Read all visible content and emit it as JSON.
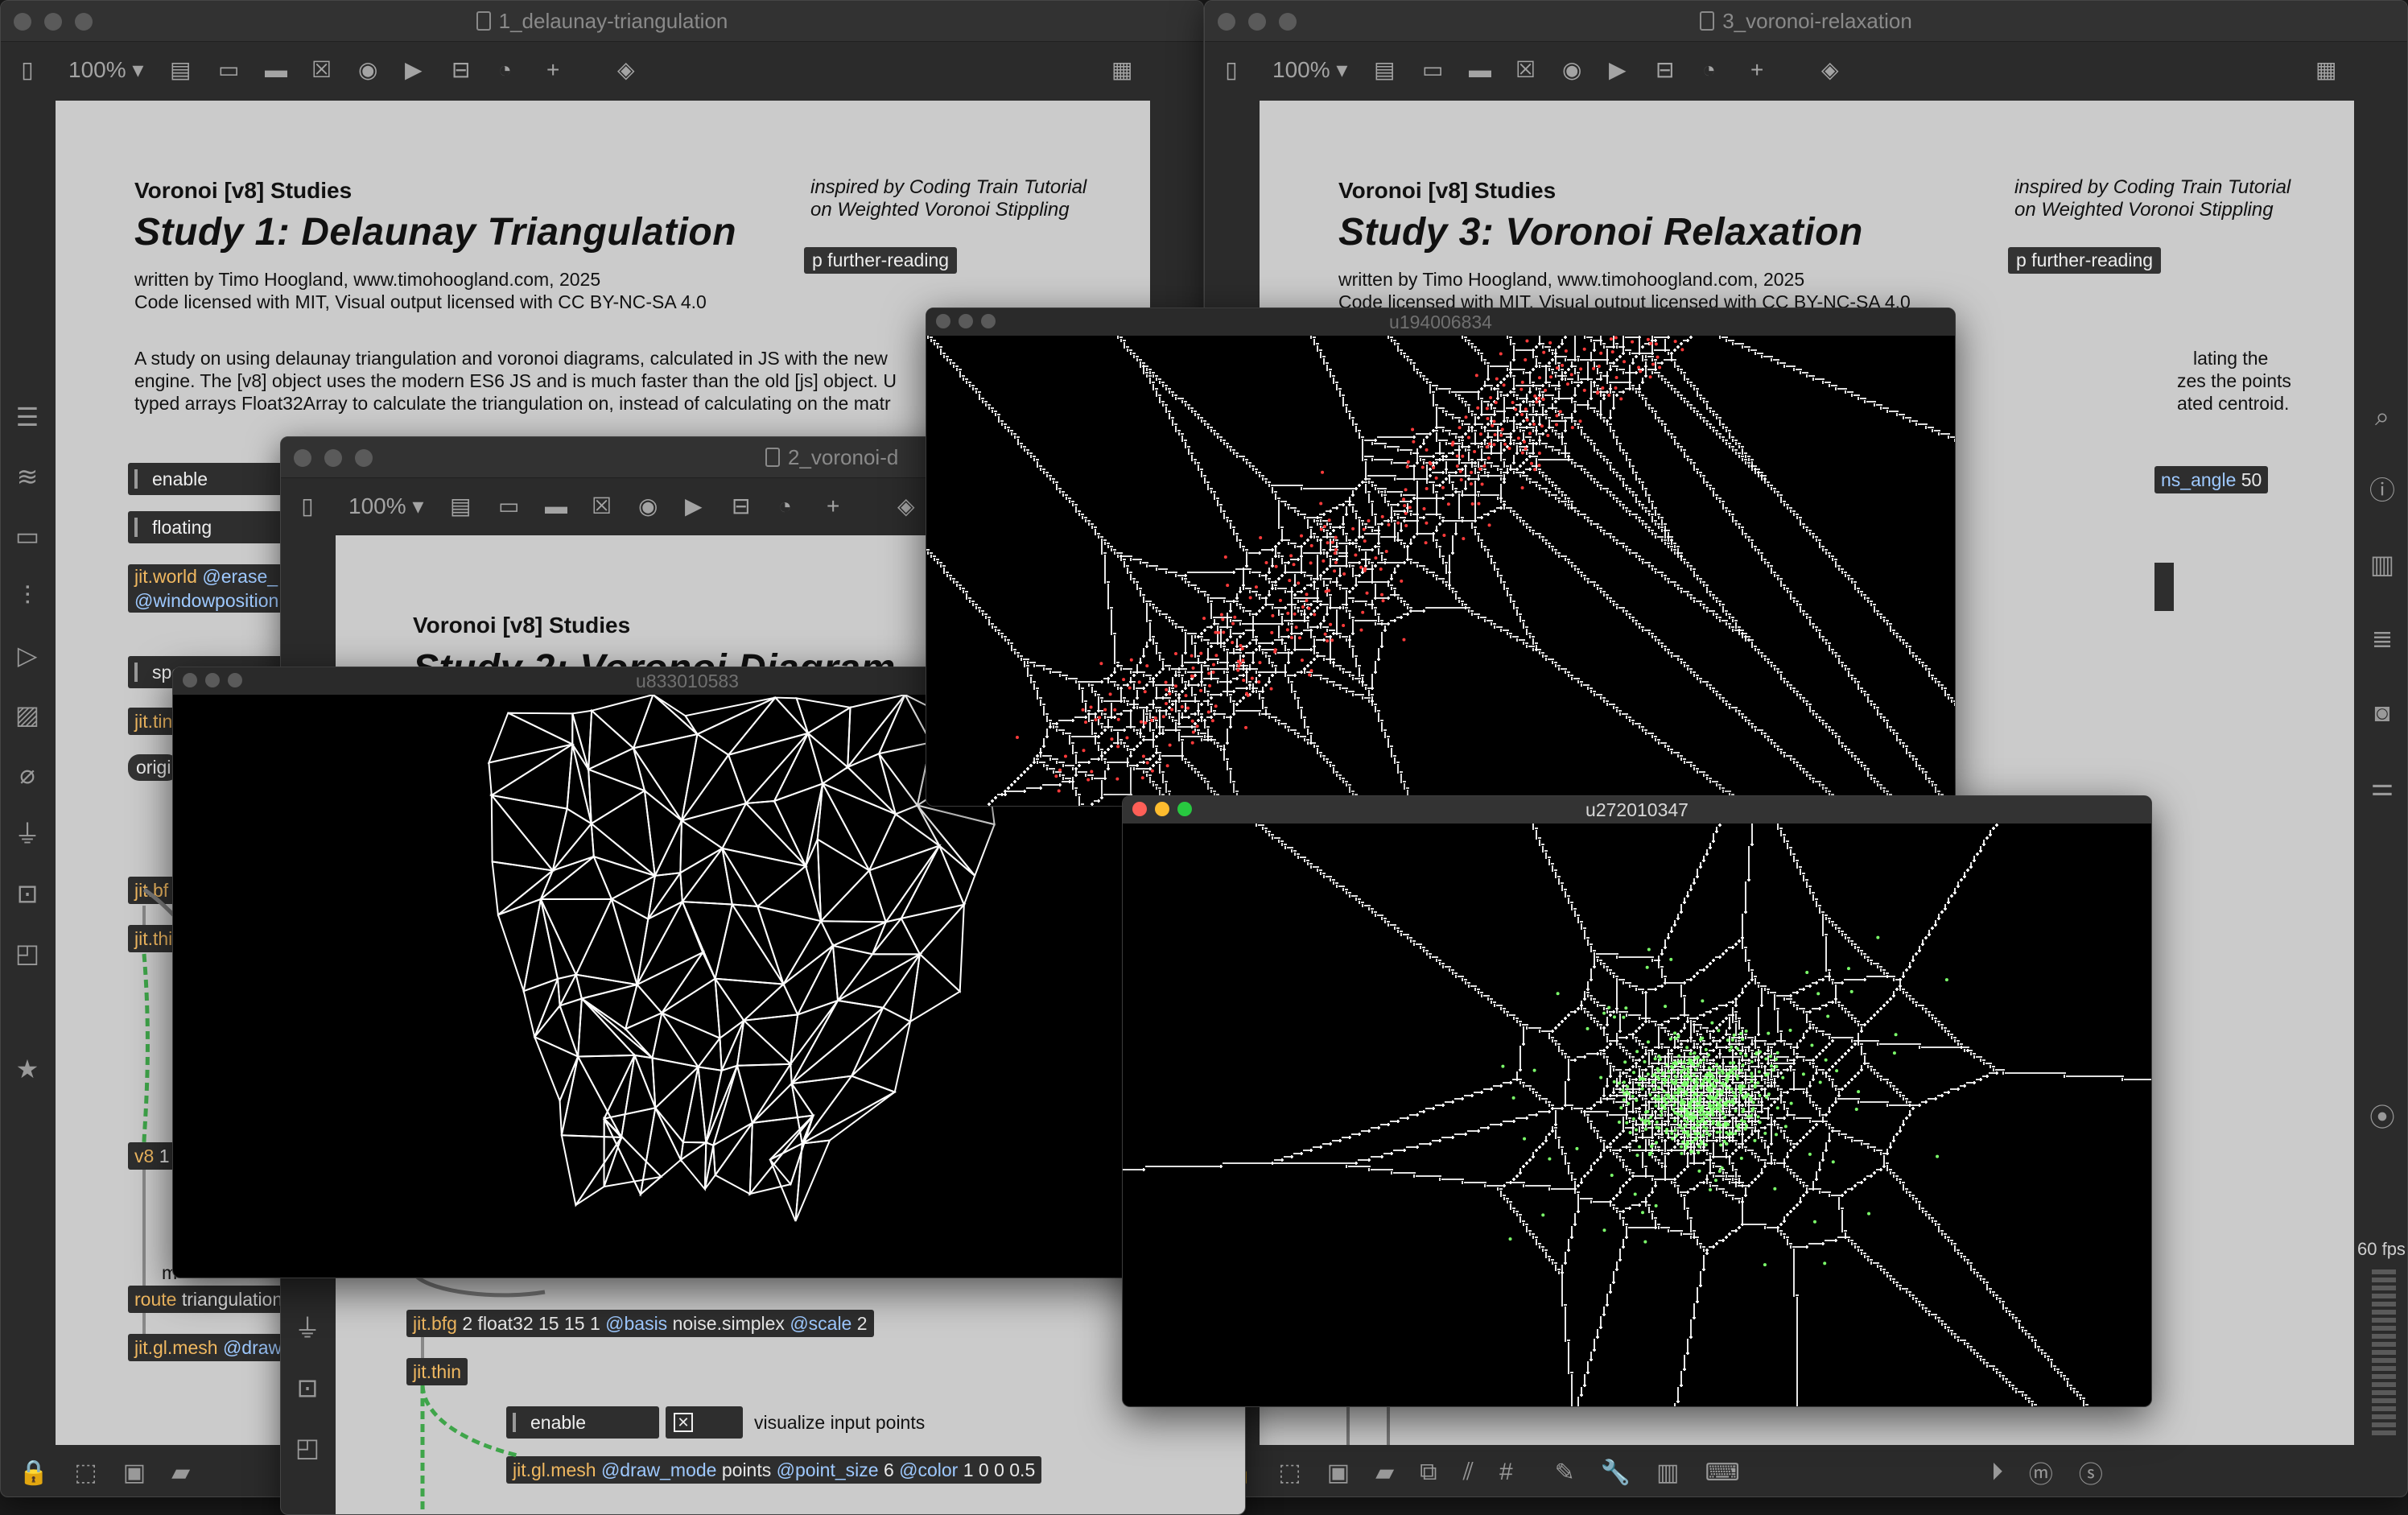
{
  "windows": {
    "w1": {
      "title": "1_delaunay-triangulation",
      "zoom": "100%",
      "series": "Voronoi [v8] Studies",
      "study_title": "Study 1: Delaunay Triangulation",
      "written_by": "written by Timo Hoogland, www.timohoogland.com, 2025",
      "license": "Code licensed with MIT, Visual output licensed with CC BY-NC-SA 4.0",
      "inspired_1": "inspired by Coding Train Tutorial",
      "inspired_2": "on Weighted Voronoi Stippling",
      "further_reading": "p further-reading",
      "desc_1": "A study on using delaunay triangulation and voronoi diagrams, calculated in JS with the new",
      "desc_2": "engine. The [v8] object uses the modern ES6 JS and is much faster than the old [js] object. U",
      "desc_3": "typed arrays Float32Array to calculate the triangulation on, instead of calculating on the matr",
      "toggle_enable": "enable",
      "toggle_floating": "floating",
      "obj_jit_world": "jit.world",
      "obj_jit_world_attr1": "@erase_",
      "obj_jit_world_attr2": "@windowposition",
      "toggle_spe": "spe",
      "obj_jit_tin": "jit.tin",
      "msg_origi": "origi",
      "obj_jit_bf": "jit.bf",
      "obj_jit_thi": "jit.thi",
      "obj_v8": "v8",
      "obj_v8_arg": "1",
      "comment_m": "m",
      "obj_route": "route",
      "obj_route_arg": "triangulation",
      "obj_mesh": "jit.gl.mesh",
      "obj_mesh_attr": "@draw"
    },
    "w2": {
      "title": "2_voronoi-d",
      "zoom": "100%",
      "series": "Voronoi [v8] Studies",
      "study_title": "Study 2: Voronoi Diagram",
      "obj_jit_bfg": "jit.bfg",
      "obj_jit_bfg_args": "2 float32 15 15 1",
      "obj_jit_bfg_attr1": "@basis",
      "obj_jit_bfg_val1": "noise.simplex",
      "obj_jit_bfg_attr2": "@scale",
      "obj_jit_bfg_val2": "2",
      "obj_jit_thin": "jit.thin",
      "toggle_enable": "enable",
      "visualize_label": "visualize input points",
      "obj_mesh": "jit.gl.mesh",
      "obj_mesh_attr1": "@draw_mode",
      "obj_mesh_val1": "points",
      "obj_mesh_attr2": "@point_size",
      "obj_mesh_val2": "6",
      "obj_mesh_attr3": "@color",
      "obj_mesh_val3": "1 0 0 0.5"
    },
    "w3": {
      "title": "3_voronoi-relaxation",
      "zoom": "100%",
      "series": "Voronoi [v8] Studies",
      "study_title": "Study 3: Voronoi Relaxation",
      "written_by": "written by Timo Hoogland, www.timohoogland.com, 2025",
      "license": "Code licensed with MIT, Visual output licensed with CC BY-NC-SA 4.0",
      "inspired_1": "inspired by Coding Train Tutorial",
      "inspired_2": "on Weighted Voronoi Stippling",
      "further_reading": "p further-reading",
      "side_text_1": "lating the",
      "side_text_2": "zes the points",
      "side_text_3": "ated centroid.",
      "param_label": "ns_angle",
      "param_value": "50",
      "fps": "60 fps"
    }
  },
  "render_windows": {
    "r1": {
      "title": "u833010583"
    },
    "r2": {
      "title": "u194006834"
    },
    "r3": {
      "title": "u272010347"
    }
  },
  "colors": {
    "canvas": "#cbcbcb",
    "chrome": "#2b2b2b",
    "object_text": "#f0b860",
    "attribute_text": "#9ec9ff",
    "points_r2": "#ff3b3b",
    "points_r3": "#7cff6b",
    "lines": "#ffffff"
  }
}
